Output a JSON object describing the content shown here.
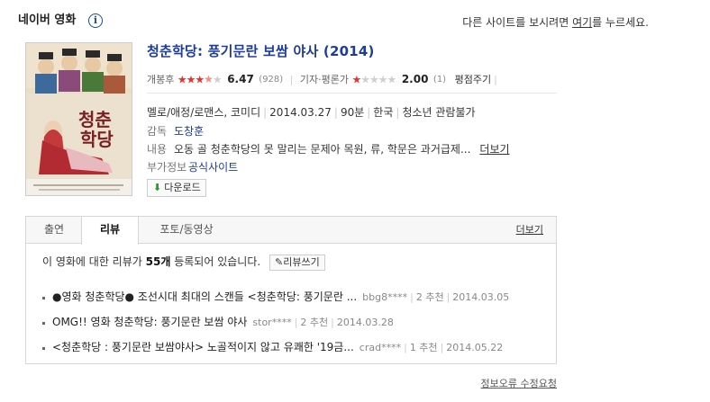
{
  "header": {
    "brand": "네이버 영화",
    "notice_before": "다른 사이트를 보시려면",
    "notice_link": "여기",
    "notice_after": "를 누르세요."
  },
  "movie": {
    "title": "청춘학당: 풍기문란 보쌈 야사 (2014)",
    "audience_label": "개봉후",
    "audience_score": "6.47",
    "audience_count": "(928)",
    "audience_stars": 3.5,
    "critic_label": "기자·평론가",
    "critic_score": "2.00",
    "critic_count": "(1)",
    "critic_stars": 1,
    "rate_button": "평점주기",
    "genre": "멜로/애정/로맨스, 코미디",
    "release_date": "2014.03.27",
    "runtime": "90분",
    "country": "한국",
    "age_rating": "청소년 관람불가",
    "director_label": "감독",
    "director": "도창훈",
    "content_label": "내용",
    "content": "오동 골 청춘학당의 못 말리는 문제아 목원, 류, 학문은 과거급제...",
    "content_more": "더보기",
    "extra_label": "부가정보",
    "extra_link": "공식사이트",
    "download": "다운로드"
  },
  "tabs": [
    {
      "label": "출연"
    },
    {
      "label": "리뷰"
    },
    {
      "label": "포토/동영상"
    }
  ],
  "tab_more": "더보기",
  "reviews": {
    "count_prefix": "이 영화에 대한 리뷰가",
    "count": "55개",
    "count_suffix": "등록되어 있습니다.",
    "write_button": "리뷰쓰기",
    "items": [
      {
        "title": "●영화 청춘학당● 조선시대 최대의 스캔들 <청춘학당: 풍기문란 ...",
        "author": "bbg8****",
        "recommend": "2 추천",
        "date": "2014.03.05"
      },
      {
        "title": "OMG!! 영화 청춘학당: 풍기문란 보쌈 야사",
        "author": "stor****",
        "recommend": "2 추천",
        "date": "2014.03.28"
      },
      {
        "title": "<청춘학당 : 풍기문란 보쌈야사> 노골적이지 않고 유쾌한 '19금...",
        "author": "crad****",
        "recommend": "1 추천",
        "date": "2014.05.22"
      }
    ]
  },
  "footer": {
    "error_report": "정보오류 수정요청"
  }
}
